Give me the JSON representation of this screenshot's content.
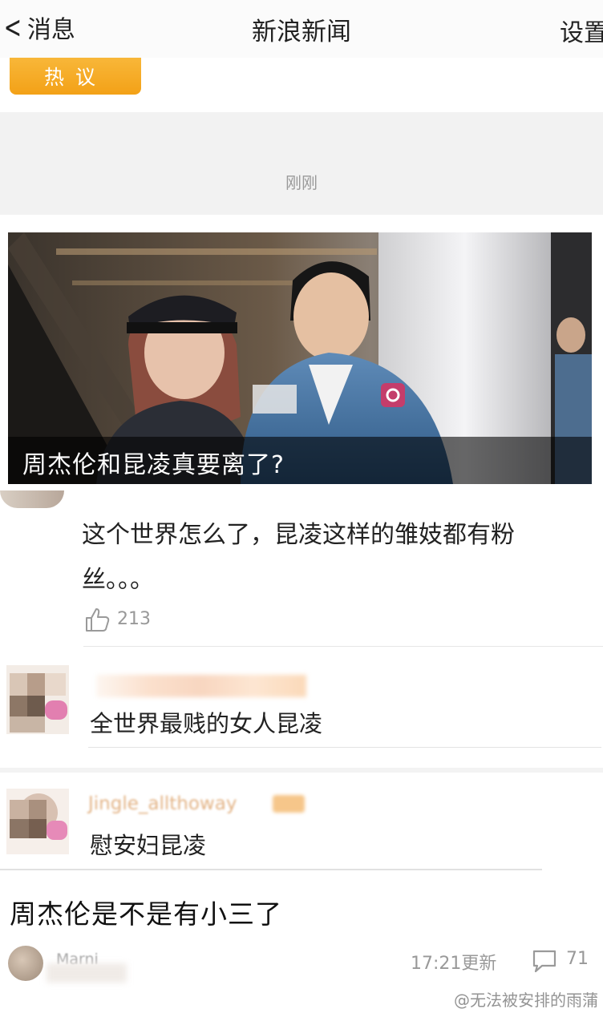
{
  "nav": {
    "back_label": "消息",
    "title": "新浪新闻",
    "settings_label": "设置"
  },
  "tag": {
    "hot_label": "热议"
  },
  "feed": {
    "timestamp": "刚刚",
    "photo_caption": "周杰伦和昆凌真要离了?"
  },
  "comments": [
    {
      "text": "这个世界怎么了，昆凌这样的雏妓都有粉丝。。。",
      "likes": "213"
    },
    {
      "text": "全世界最贱的女人昆凌"
    },
    {
      "username": "Jingle_allthoway",
      "text": "慰安妇昆凌"
    }
  ],
  "post": {
    "headline": "周杰伦是不是有小三了",
    "author": "Marni",
    "updated": "17:21更新",
    "comment_count": "71"
  },
  "watermark": "@无法被安排的雨蒲",
  "colors": {
    "hot_tag": "#f5a623",
    "caption_overlay": "#000000",
    "muted_text": "#999999"
  }
}
